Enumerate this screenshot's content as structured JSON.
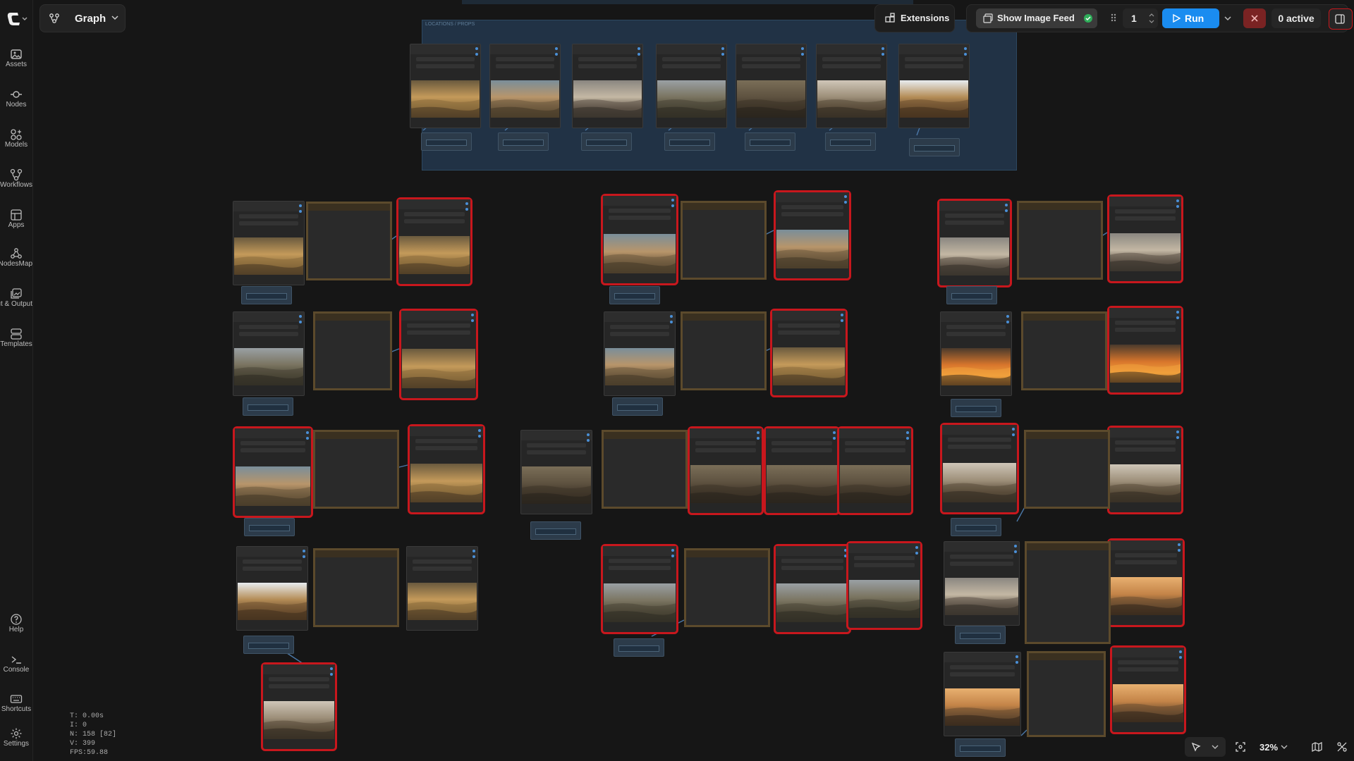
{
  "app": {
    "tab_title": "Graph"
  },
  "sidebar": {
    "items": [
      {
        "label": "Assets",
        "icon": "image-icon"
      },
      {
        "label": "Nodes",
        "icon": "node-icon"
      },
      {
        "label": "Models",
        "icon": "models-icon"
      },
      {
        "label": "Workflows",
        "icon": "workflow-icon"
      },
      {
        "label": "Apps",
        "icon": "apps-icon"
      },
      {
        "label": "NodesMap",
        "icon": "nodes-map-icon"
      },
      {
        "label": "Input & Output",
        "icon": "input-output-icon"
      },
      {
        "label": "Templates",
        "icon": "templates-icon"
      }
    ],
    "bottom_items": [
      {
        "label": "Help",
        "icon": "help-icon"
      },
      {
        "label": "Console",
        "icon": "console-icon"
      },
      {
        "label": "Shortcuts",
        "icon": "keyboard-icon"
      },
      {
        "label": "Settings",
        "icon": "gear-icon"
      }
    ]
  },
  "topbar": {
    "extensions_label": "Extensions",
    "show_image_feed_label": "Show Image Feed",
    "queue_count": "1",
    "run_label": "Run",
    "active_label": "0 active"
  },
  "group": {
    "title": "LOCATIONS / PROPS"
  },
  "stats": {
    "t": "T: 0.00s",
    "i": "I: 0",
    "n": "N: 158 [82]",
    "v": "V: 399",
    "fps": "FPS:59.88"
  },
  "bottombar": {
    "zoom_label": "32%"
  },
  "colors": {
    "accent": "#1a8cf0",
    "selected": "#c8171d",
    "group": "#213245",
    "prompt_border": "#5c4a2c"
  }
}
